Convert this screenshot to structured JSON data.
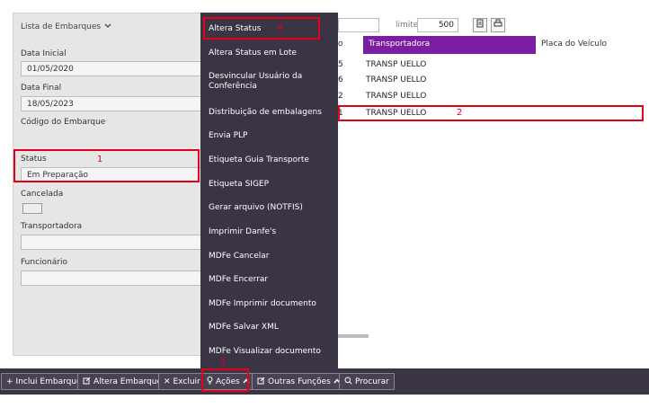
{
  "filters": {
    "title": "Lista de Embarques",
    "data_inicial_label": "Data Inicial",
    "data_inicial_value": "01/05/2020",
    "data_final_label": "Data Final",
    "data_final_value": "18/05/2023",
    "codigo_label": "Código do Embarque",
    "status_label": "Status",
    "status_value": "Em Preparação",
    "cancelada_label": "Cancelada",
    "transportadora_label": "Transportadora",
    "funcionario_label": "Funcionário"
  },
  "grid": {
    "limite_label": "limite:",
    "limite_value": "500",
    "columns": [
      "o",
      "Transportadora",
      "Placa do Veículo"
    ],
    "rows": [
      {
        "num": "5",
        "transportadora": "TRANSP UELLO"
      },
      {
        "num": "6",
        "transportadora": "TRANSP UELLO"
      },
      {
        "num": "2",
        "transportadora": "TRANSP UELLO"
      },
      {
        "num": "1",
        "transportadora": "TRANSP UELLO"
      }
    ]
  },
  "menu": {
    "items": [
      "Altera Status",
      "Altera Status em Lote",
      "Desvincular Usuário da Conferência",
      "Distribuição de embalagens",
      "Envia PLP",
      "Etiqueta Guia Transporte",
      "Etiqueta SIGEP",
      "Gerar arquivo (NOTFIS)",
      "Imprimir Danfe's",
      "MDFe Cancelar",
      "MDFe Encerrar",
      "MDFe Imprimir documento",
      "MDFe Salvar XML",
      "MDFe Visualizar documento"
    ]
  },
  "toolbar": {
    "inclui": "Inclui Embarque",
    "altera": "Altera Embarque",
    "excluir": "Excluir",
    "acoes": "Ações",
    "outras": "Outras Funções",
    "procurar": "Procurar"
  },
  "annotations": {
    "n1": "1",
    "n2": "2",
    "n3": "3",
    "n4": "4"
  },
  "colors": {
    "menu_bg": "#3b3444",
    "grid_header_bg": "#7b1fa2",
    "highlight_red": "#e3001b"
  }
}
